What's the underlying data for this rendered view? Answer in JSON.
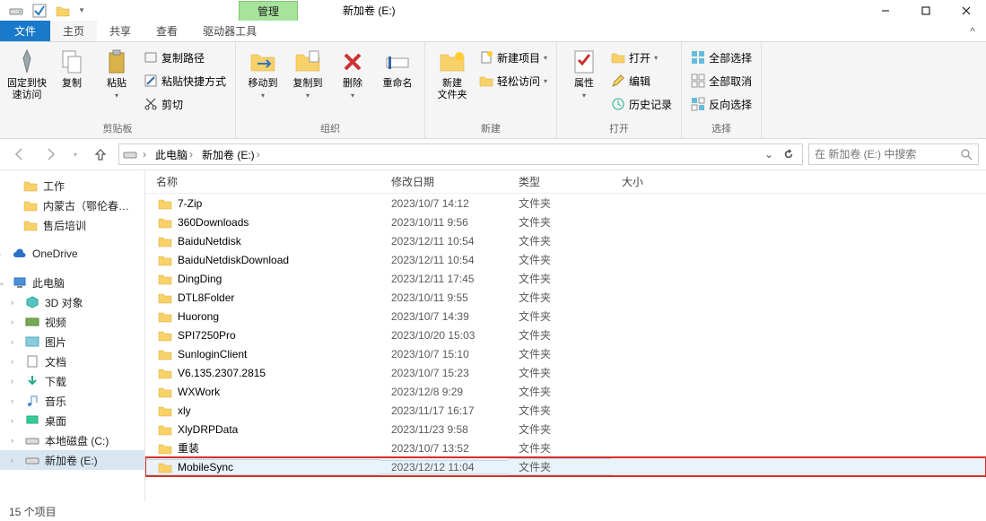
{
  "window": {
    "title": "新加卷 (E:)"
  },
  "tabs": {
    "file": "文件",
    "home": "主页",
    "share": "共享",
    "view": "查看",
    "manage": "管理",
    "drive_tools": "驱动器工具"
  },
  "ribbon": {
    "clipboard": {
      "label": "剪贴板",
      "pin": "固定到快\n速访问",
      "copy": "复制",
      "paste": "粘贴",
      "copy_path": "复制路径",
      "paste_shortcut": "粘贴快捷方式",
      "cut": "剪切"
    },
    "organize": {
      "label": "组织",
      "move_to": "移动到",
      "copy_to": "复制到",
      "delete": "删除",
      "rename": "重命名"
    },
    "new": {
      "label": "新建",
      "new_folder": "新建\n文件夹",
      "new_item": "新建项目",
      "easy_access": "轻松访问"
    },
    "open": {
      "label": "打开",
      "properties": "属性",
      "open": "打开",
      "edit": "编辑",
      "history": "历史记录"
    },
    "select": {
      "label": "选择",
      "select_all": "全部选择",
      "select_none": "全部取消",
      "invert": "反向选择"
    }
  },
  "breadcrumb": {
    "this_pc": "此电脑",
    "drive": "新加卷 (E:)"
  },
  "search": {
    "placeholder": "在 新加卷 (E:) 中搜索"
  },
  "nav": {
    "work": "工作",
    "neimeng": "内蒙古（鄂伦春…",
    "after_sales": "售后培训",
    "onedrive": "OneDrive",
    "this_pc": "此电脑",
    "objects3d": "3D 对象",
    "videos": "视频",
    "pictures": "图片",
    "documents": "文档",
    "downloads": "下载",
    "music": "音乐",
    "desktop": "桌面",
    "cdrive": "本地磁盘 (C:)",
    "edrive": "新加卷 (E:)"
  },
  "columns": {
    "name": "名称",
    "date": "修改日期",
    "type": "类型",
    "size": "大小"
  },
  "rows": [
    {
      "name": "7-Zip",
      "date": "2023/10/7 14:12",
      "type": "文件夹"
    },
    {
      "name": "360Downloads",
      "date": "2023/10/11 9:56",
      "type": "文件夹"
    },
    {
      "name": "BaiduNetdisk",
      "date": "2023/12/11 10:54",
      "type": "文件夹"
    },
    {
      "name": "BaiduNetdiskDownload",
      "date": "2023/12/11 10:54",
      "type": "文件夹"
    },
    {
      "name": "DingDing",
      "date": "2023/12/11 17:45",
      "type": "文件夹"
    },
    {
      "name": "DTL8Folder",
      "date": "2023/10/11 9:55",
      "type": "文件夹"
    },
    {
      "name": "Huorong",
      "date": "2023/10/7 14:39",
      "type": "文件夹"
    },
    {
      "name": "SPI7250Pro",
      "date": "2023/10/20 15:03",
      "type": "文件夹"
    },
    {
      "name": "SunloginClient",
      "date": "2023/10/7 15:10",
      "type": "文件夹"
    },
    {
      "name": "V6.135.2307.2815",
      "date": "2023/10/7 15:23",
      "type": "文件夹"
    },
    {
      "name": "WXWork",
      "date": "2023/12/8 9:29",
      "type": "文件夹"
    },
    {
      "name": "xly",
      "date": "2023/11/17 16:17",
      "type": "文件夹"
    },
    {
      "name": "XlyDRPData",
      "date": "2023/11/23 9:58",
      "type": "文件夹"
    },
    {
      "name": "重装",
      "date": "2023/10/7 13:52",
      "type": "文件夹"
    },
    {
      "name": "MobileSync",
      "date": "2023/12/12 11:04",
      "type": "文件夹",
      "highlight": true
    }
  ],
  "status": {
    "count": "15 个项目"
  }
}
